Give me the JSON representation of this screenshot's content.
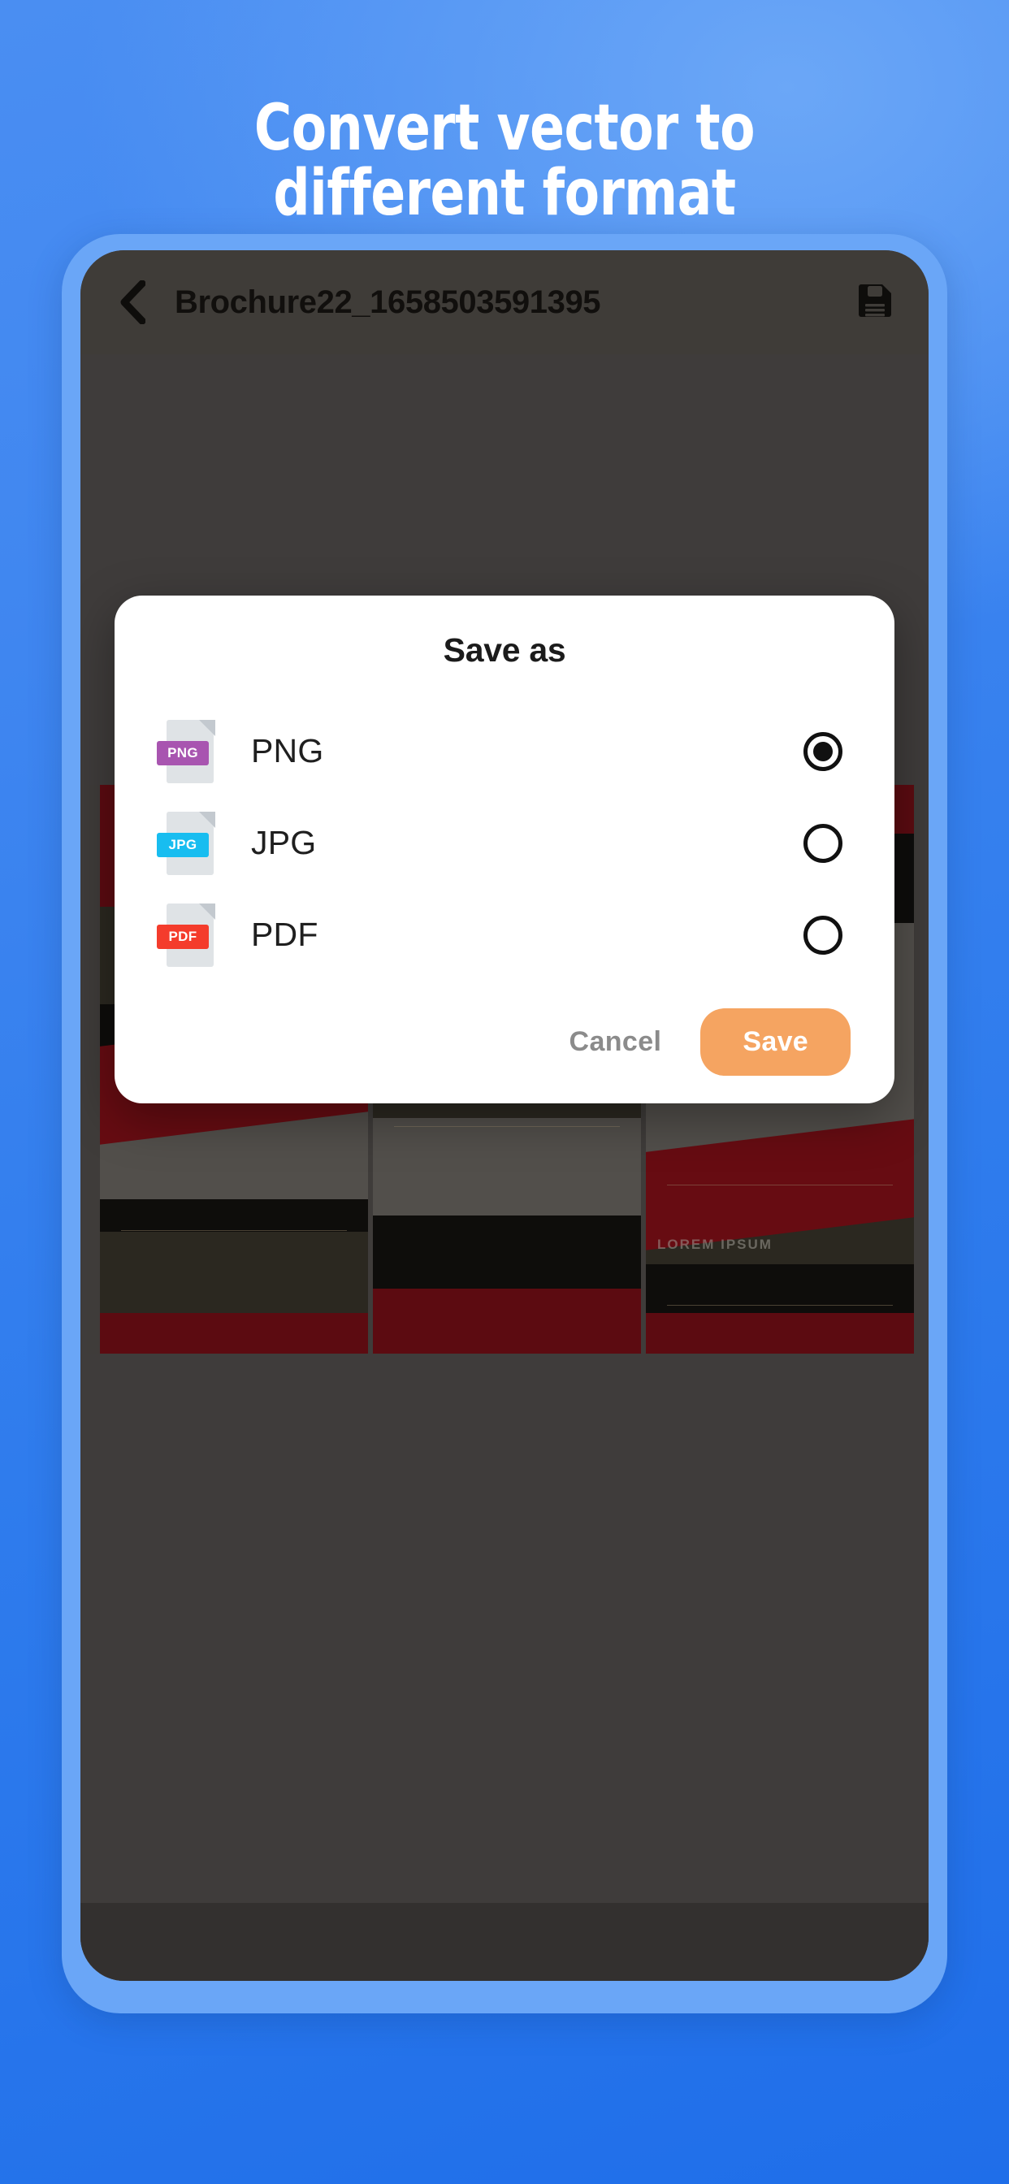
{
  "promo": {
    "headline_line1": "Convert vector to",
    "headline_line2": "different format",
    "background_color_top": "#4a8ef2",
    "background_color_bottom": "#1f6ee9",
    "headline_color": "#ffffff"
  },
  "phone": {
    "bezel_color": "#6aa6f7",
    "screen_color": "#4c4945"
  },
  "app": {
    "header": {
      "back_icon": "chevron-left-icon",
      "title": "Brochure22_1658503591395",
      "save_icon": "floppy-disk-save-icon",
      "background_color": "#55514c",
      "title_color": "#171512"
    },
    "canvas": {
      "background_color": "#565250",
      "artwork_label": "LOREM IPSUM"
    }
  },
  "dialog": {
    "title": "Save as",
    "options": [
      {
        "label": "PNG",
        "icon": "png-file-icon",
        "badge_text": "PNG",
        "badge_color": "#a855b0",
        "selected": true
      },
      {
        "label": "JPG",
        "icon": "jpg-file-icon",
        "badge_text": "JPG",
        "badge_color": "#18bdf0",
        "selected": false
      },
      {
        "label": "PDF",
        "icon": "pdf-file-icon",
        "badge_text": "PDF",
        "badge_color": "#f43c2c",
        "selected": false
      }
    ],
    "cancel_label": "Cancel",
    "save_label": "Save",
    "save_button_color": "#f5a461",
    "cancel_text_color": "#8b8b8b",
    "surface_color": "#ffffff"
  }
}
